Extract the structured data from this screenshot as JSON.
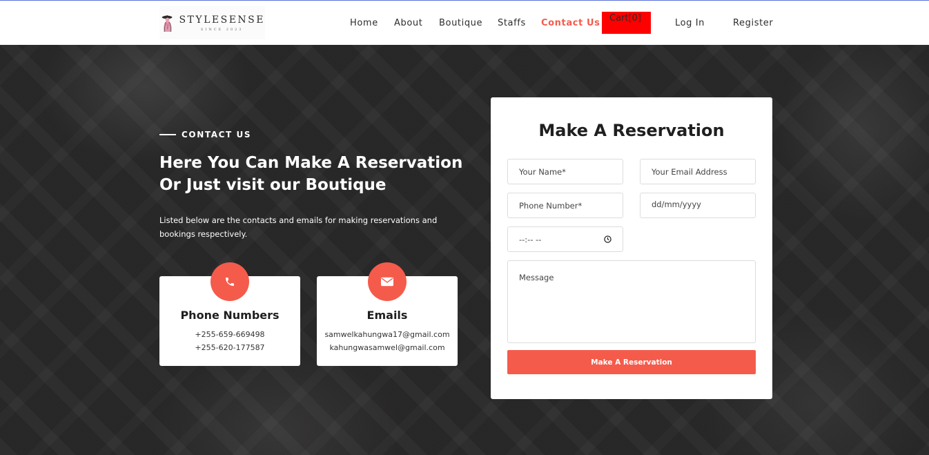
{
  "brand": {
    "name": "STYLESENSE",
    "tagline": "SINCE 2023"
  },
  "nav": {
    "home": "Home",
    "about": "About",
    "boutique": "Boutique",
    "staffs": "Staffs",
    "contact": "Contact Us",
    "cart": "Cart[0]",
    "login": "Log In",
    "register": "Register"
  },
  "hero": {
    "eyebrow": "CONTACT US",
    "title_line1": "Here You Can Make A Reservation",
    "title_line2": "Or Just visit our Boutique",
    "desc_line1": "Listed below are the contacts and emails for making reservations and",
    "desc_line2": "bookings respectively."
  },
  "cards": {
    "phone": {
      "icon": "phone-icon",
      "title": "Phone Numbers",
      "line1": "+255-659-669498",
      "line2": "+255-620-177587"
    },
    "email": {
      "icon": "envelope-icon",
      "title": "Emails",
      "line1": "samwelkahungwa17@gmail.com",
      "line2": "kahungwasamwel@gmail.com"
    }
  },
  "form": {
    "title": "Make A Reservation",
    "name_placeholder": "Your Name*",
    "email_placeholder": "Your Email Address",
    "phone_placeholder": "Phone Number*",
    "date_placeholder": "dd/mm/yyyy",
    "time_placeholder": "--:-- --",
    "message_placeholder": "Message",
    "submit_label": "Make A Reservation"
  },
  "colors": {
    "accent": "#f45b4b",
    "cart_bg": "#ff0000",
    "hero_bg": "#2b2a2a"
  }
}
